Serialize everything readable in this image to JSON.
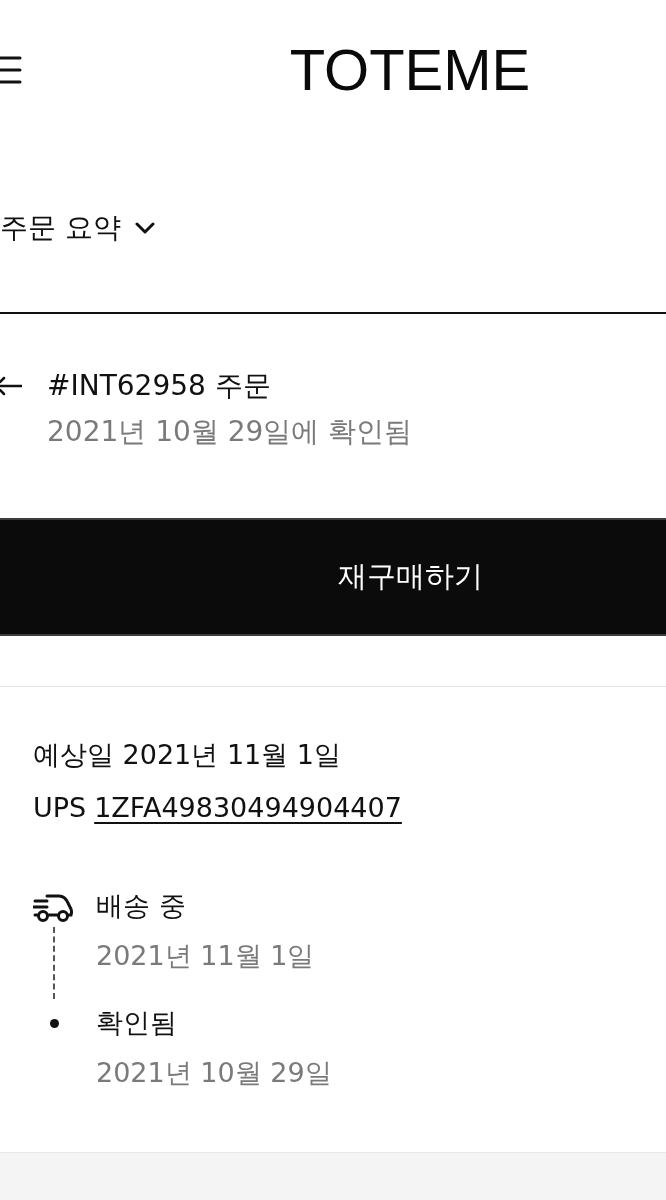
{
  "header": {
    "logo": "TOTEME"
  },
  "summary": {
    "label": "주문 요약",
    "expanded": false
  },
  "order": {
    "number": "#INT62958 주문",
    "status": "2021년 10월 29일에 확인됨"
  },
  "reorder_button": {
    "label": "재구매하기"
  },
  "shipment": {
    "estimate": "예상일 2021년 11월 1일",
    "carrier": "UPS",
    "tracking": "1ZFA49830494904407",
    "events": [
      {
        "kind": "truck",
        "title": "배송 중",
        "date": "2021년 11월 1일"
      },
      {
        "kind": "dot",
        "title": "확인됨",
        "date": "2021년 10월 29일"
      }
    ]
  }
}
